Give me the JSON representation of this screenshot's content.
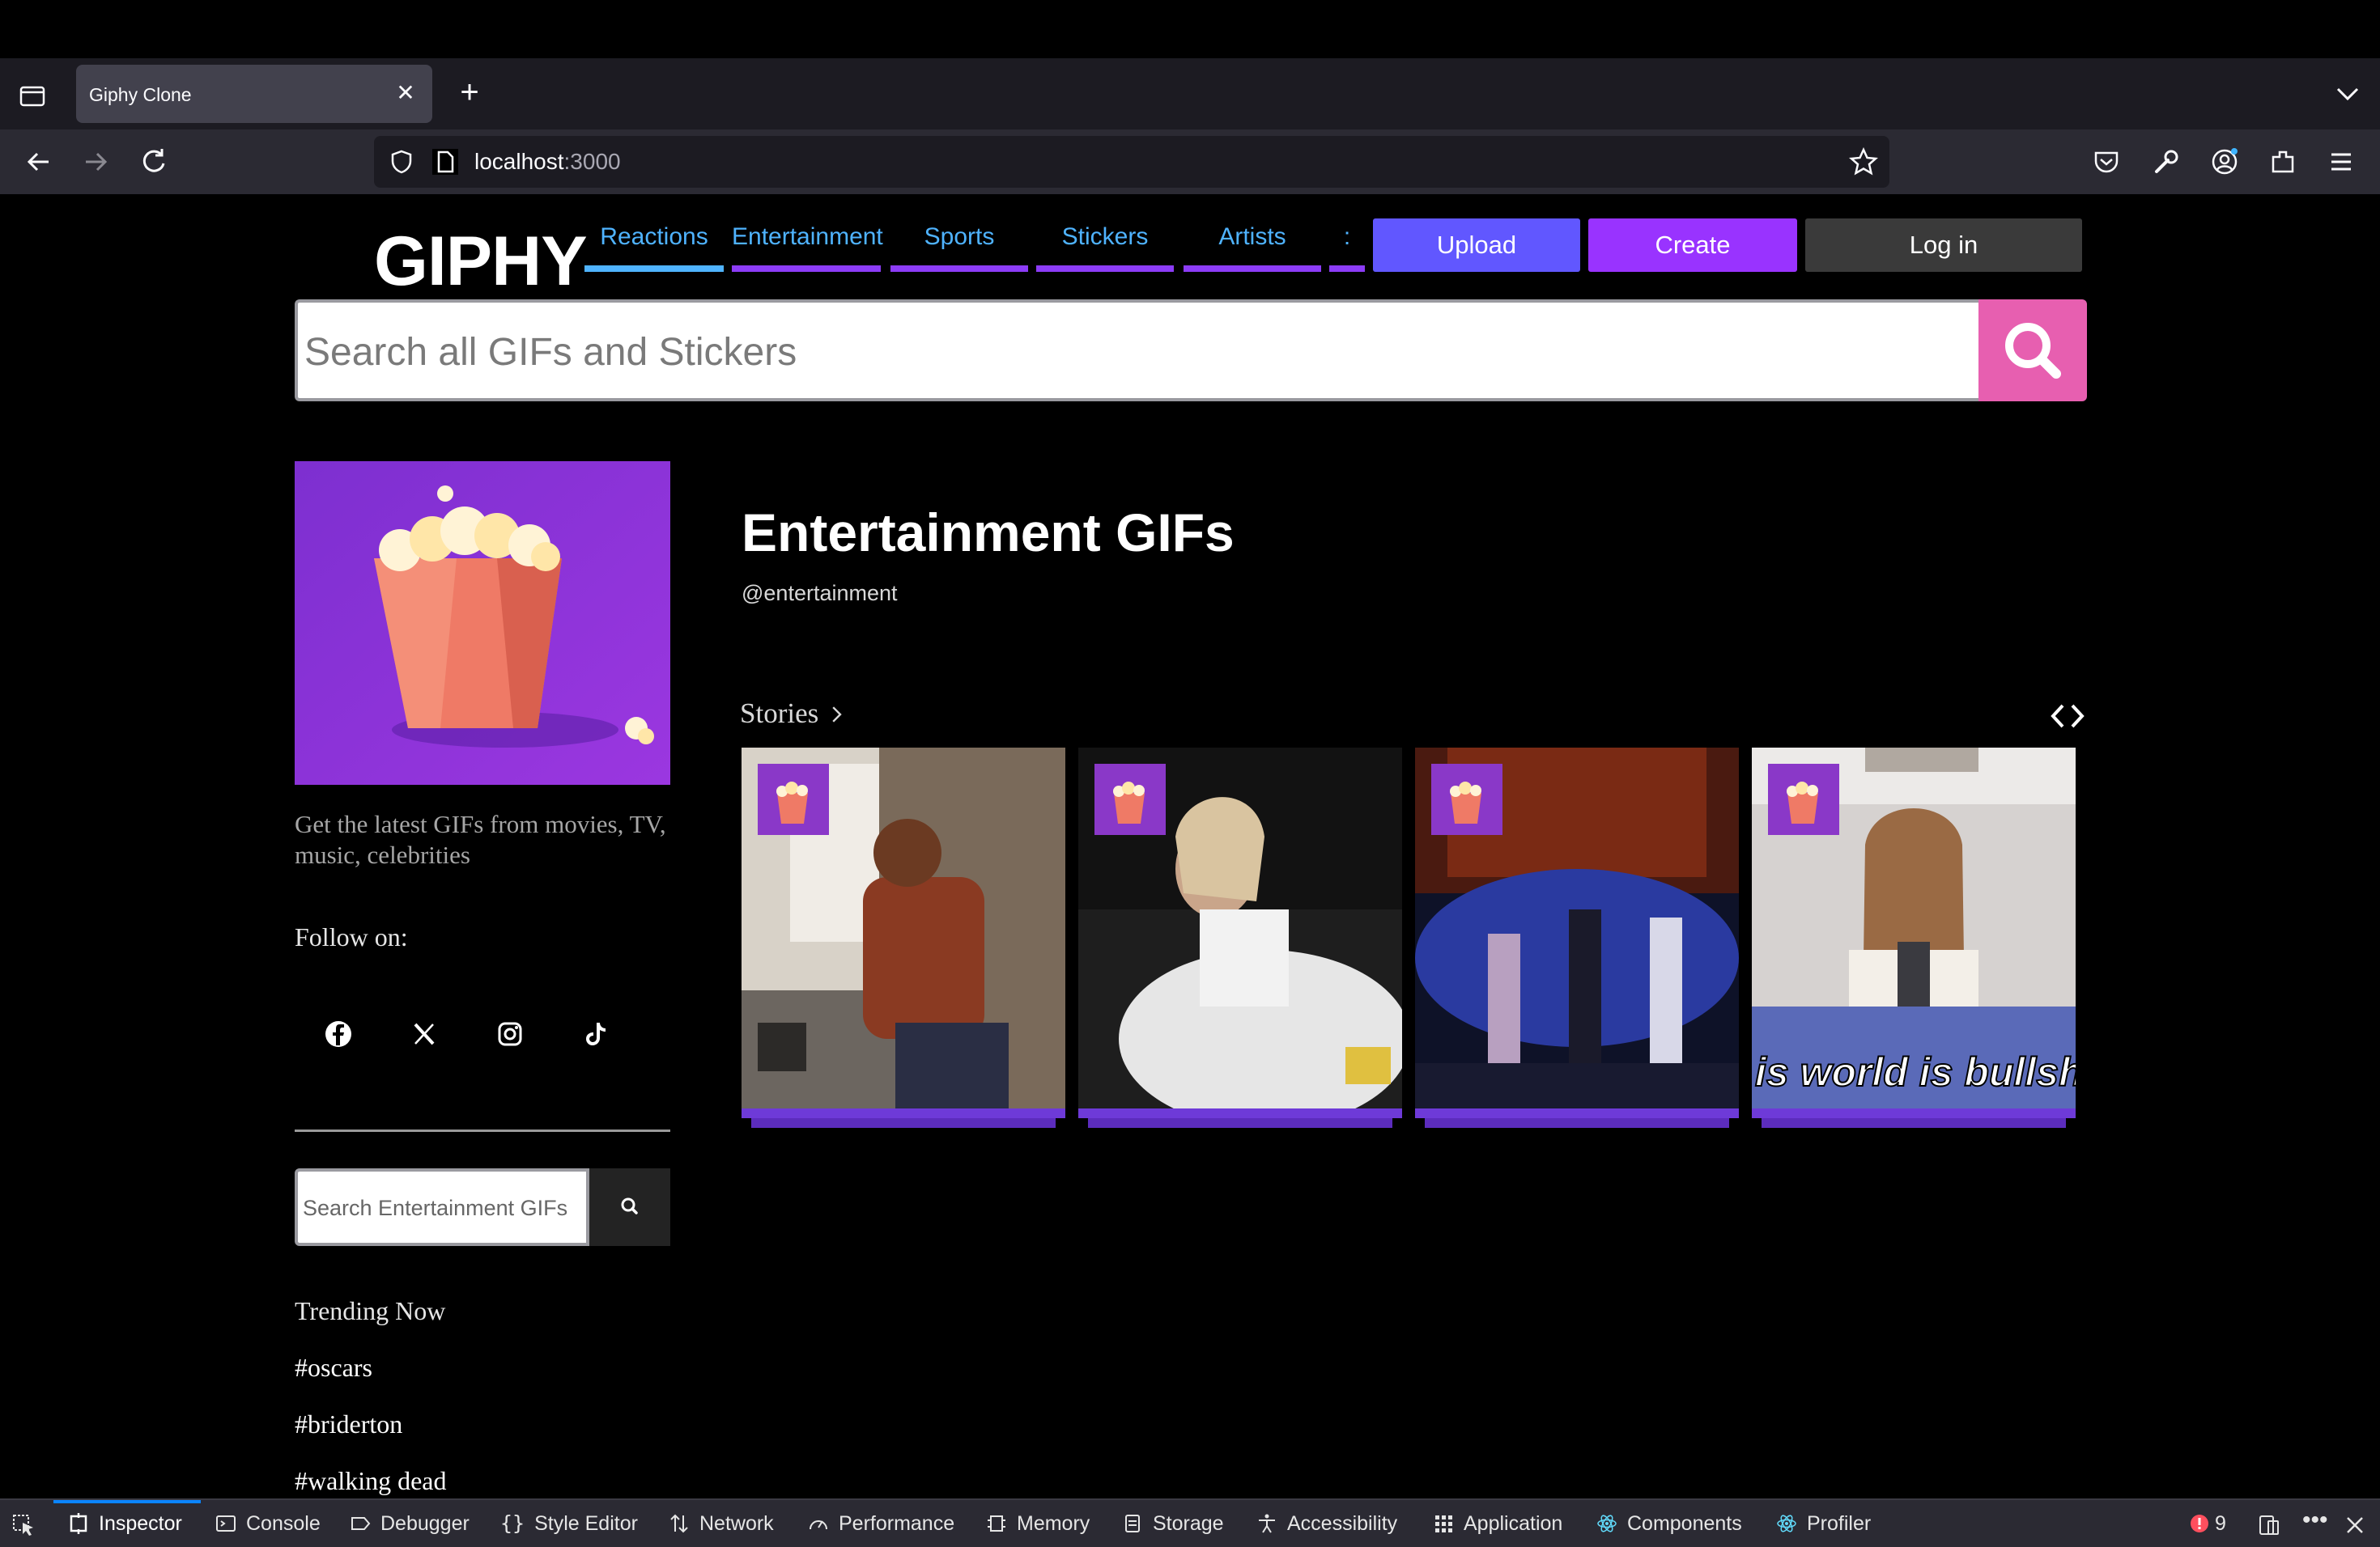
{
  "browser": {
    "tab_title": "Giphy Clone",
    "url_host": "localhost",
    "url_port": ":3000"
  },
  "header": {
    "logo": "GIPHY",
    "nav": [
      {
        "label": "Reactions",
        "color": "#4fb3ff"
      },
      {
        "label": "Entertainment",
        "color": "#8c3cf7"
      },
      {
        "label": "Sports",
        "color": "#8c3cf7"
      },
      {
        "label": "Stickers",
        "color": "#8c3cf7"
      },
      {
        "label": "Artists",
        "color": "#8c3cf7"
      },
      {
        "label": ":",
        "color": "#8c3cf7"
      }
    ],
    "upload": "Upload",
    "create": "Create",
    "login": "Log in"
  },
  "search": {
    "placeholder": "Search all GIFs and Stickers",
    "icon": "search-icon"
  },
  "sidebar": {
    "description": "Get the latest GIFs from movies, TV, music, celebrities",
    "follow_label": "Follow on:",
    "social": [
      "facebook-icon",
      "x-icon",
      "instagram-icon",
      "tiktok-icon"
    ],
    "search_placeholder": "Search Entertainment GIFs",
    "trending_title": "Trending Now",
    "trending_tags": [
      "#oscars",
      "#briderton",
      "#walking dead"
    ]
  },
  "main": {
    "title": "Entertainment GIFs",
    "handle": "@entertainment",
    "stories_label": "Stories",
    "story_cards": [
      {
        "caption": ""
      },
      {
        "caption": ""
      },
      {
        "caption": ""
      },
      {
        "caption": "is world is bullsh"
      }
    ]
  },
  "devtools": {
    "tabs": [
      "Inspector",
      "Console",
      "Debugger",
      "Style Editor",
      "Network",
      "Performance",
      "Memory",
      "Storage",
      "Accessibility",
      "Application",
      "Components",
      "Profiler"
    ],
    "error_count": "9"
  },
  "colors": {
    "accent_purple": "#8c3cf7",
    "upload_blue": "#6157ff",
    "search_pink": "#e75fb0",
    "nav_blue": "#4fb3ff"
  }
}
